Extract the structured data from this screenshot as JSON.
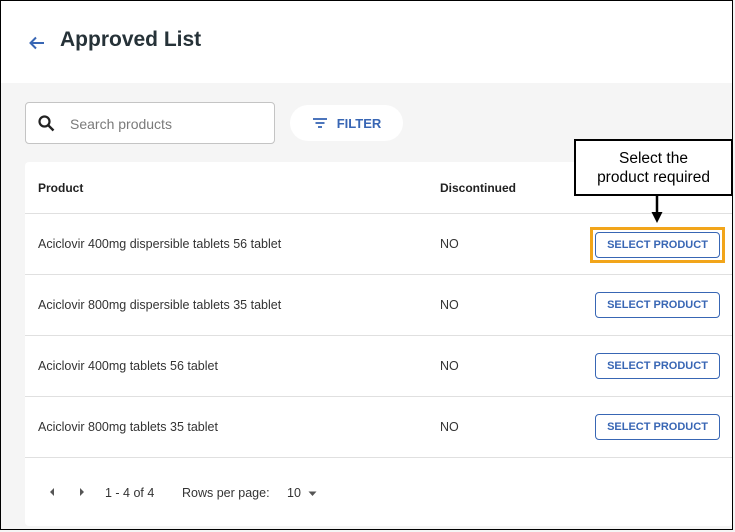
{
  "header": {
    "title": "Approved List",
    "back_icon": "arrow-left-icon"
  },
  "search": {
    "placeholder": "Search products",
    "value": ""
  },
  "filter": {
    "label": "FILTER"
  },
  "table": {
    "columns": [
      "Product",
      "Discontinued"
    ],
    "rows": [
      {
        "product": "Aciclovir 400mg dispersible tablets 56 tablet",
        "discontinued": "NO",
        "action": "SELECT PRODUCT"
      },
      {
        "product": "Aciclovir 800mg dispersible tablets 35 tablet",
        "discontinued": "NO",
        "action": "SELECT PRODUCT"
      },
      {
        "product": "Aciclovir 400mg tablets 56 tablet",
        "discontinued": "NO",
        "action": "SELECT PRODUCT"
      },
      {
        "product": "Aciclovir 800mg tablets 35 tablet",
        "discontinued": "NO",
        "action": "SELECT PRODUCT"
      }
    ]
  },
  "pagination": {
    "range": "1 - 4 of 4",
    "rows_per_page_label": "Rows per page:",
    "rows_per_page_value": "10"
  },
  "callout": {
    "line1": "Select the",
    "line2": "product required"
  },
  "colors": {
    "accent": "#3866b4",
    "highlight": "#f2a51a"
  }
}
